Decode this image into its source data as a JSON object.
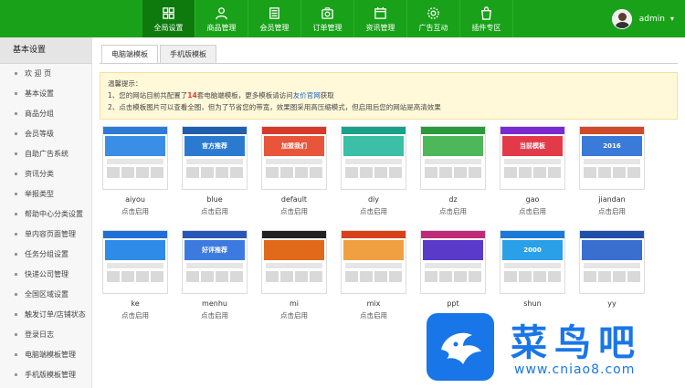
{
  "header": {
    "nav": [
      {
        "label": "全局设置",
        "icon": "grid-icon",
        "active": true
      },
      {
        "label": "商品管理",
        "icon": "person-icon",
        "active": false
      },
      {
        "label": "会员管理",
        "icon": "book-icon",
        "active": false
      },
      {
        "label": "订单管理",
        "icon": "camera-icon",
        "active": false
      },
      {
        "label": "资讯管理",
        "icon": "calendar-icon",
        "active": false
      },
      {
        "label": "广告互动",
        "icon": "gear-icon",
        "active": false
      },
      {
        "label": "插件专区",
        "icon": "bag-icon",
        "active": false
      }
    ],
    "user": {
      "name": "admin",
      "caret": "▾"
    }
  },
  "sidebar": {
    "title": "基本设置",
    "items": [
      {
        "label": "欢 迎 页"
      },
      {
        "label": "基本设置"
      },
      {
        "label": "商品分组"
      },
      {
        "label": "会员等级"
      },
      {
        "label": "自助广告系统"
      },
      {
        "label": "资讯分类"
      },
      {
        "label": "举报类型"
      },
      {
        "label": "帮助中心分类设置"
      },
      {
        "label": "单内容页面管理"
      },
      {
        "label": "任务分组设置"
      },
      {
        "label": "快递公司管理"
      },
      {
        "label": "全国区域设置"
      },
      {
        "label": "触发订单/店铺状态"
      },
      {
        "label": "登录日志"
      },
      {
        "label": "电脑端模板管理"
      },
      {
        "label": "手机版模板管理"
      }
    ]
  },
  "main": {
    "tabs": [
      {
        "label": "电脑端模板",
        "active": true
      },
      {
        "label": "手机版模板",
        "active": false
      }
    ],
    "notice": {
      "title": "温馨提示：",
      "line1_pre": "1、您的网站目前共配置了",
      "line1_count": "14",
      "line1_mid": "套电脑端模板，更多模板请访问",
      "line1_link": "友价官网",
      "line1_post": "获取",
      "line2": "2、点击模板图片可以查看全图，但为了节省您的带宽，效果图采用高压缩模式，但启用后您的网站是高清效果"
    },
    "action_label": "点击启用",
    "templates": [
      {
        "name": "aiyou",
        "accent": "#2e7bd6",
        "banner": "#3a8ee6",
        "banner_text": ""
      },
      {
        "name": "blue",
        "accent": "#1f5fae",
        "banner": "#2a7bd0",
        "banner_text": "官方推荐"
      },
      {
        "name": "default",
        "accent": "#d83a2a",
        "banner": "#e8553a",
        "banner_text": "加盟我们"
      },
      {
        "name": "diy",
        "accent": "#1aa18a",
        "banner": "#3bbfa6",
        "banner_text": ""
      },
      {
        "name": "dz",
        "accent": "#2a9a3a",
        "banner": "#4cb85a",
        "banner_text": ""
      },
      {
        "name": "gao",
        "accent": "#7a2ad0",
        "banner": "#e33a4a",
        "banner_text": "当前模板"
      },
      {
        "name": "jiandan",
        "accent": "#d04a2a",
        "banner": "#3a7ad8",
        "banner_text": "2016"
      },
      {
        "name": "ke",
        "accent": "#1e6fd6",
        "banner": "#2f8be8",
        "banner_text": ""
      },
      {
        "name": "menhu",
        "accent": "#2a56b8",
        "banner": "#3d7ae0",
        "banner_text": "好评推荐"
      },
      {
        "name": "mi",
        "accent": "#222222",
        "banner": "#e06a1a",
        "banner_text": ""
      },
      {
        "name": "mix",
        "accent": "#d8401a",
        "banner": "#f0a040",
        "banner_text": ""
      },
      {
        "name": "ppt",
        "accent": "#c02a7a",
        "banner": "#5a3ac8",
        "banner_text": ""
      },
      {
        "name": "shun",
        "accent": "#1a7ad8",
        "banner": "#2aa0e8",
        "banner_text": "2000"
      },
      {
        "name": "yy",
        "accent": "#1f4fa8",
        "banner": "#3a6fd0",
        "banner_text": ""
      }
    ]
  },
  "watermark": {
    "title": "菜鸟吧",
    "url": "www.cniao8.com"
  }
}
